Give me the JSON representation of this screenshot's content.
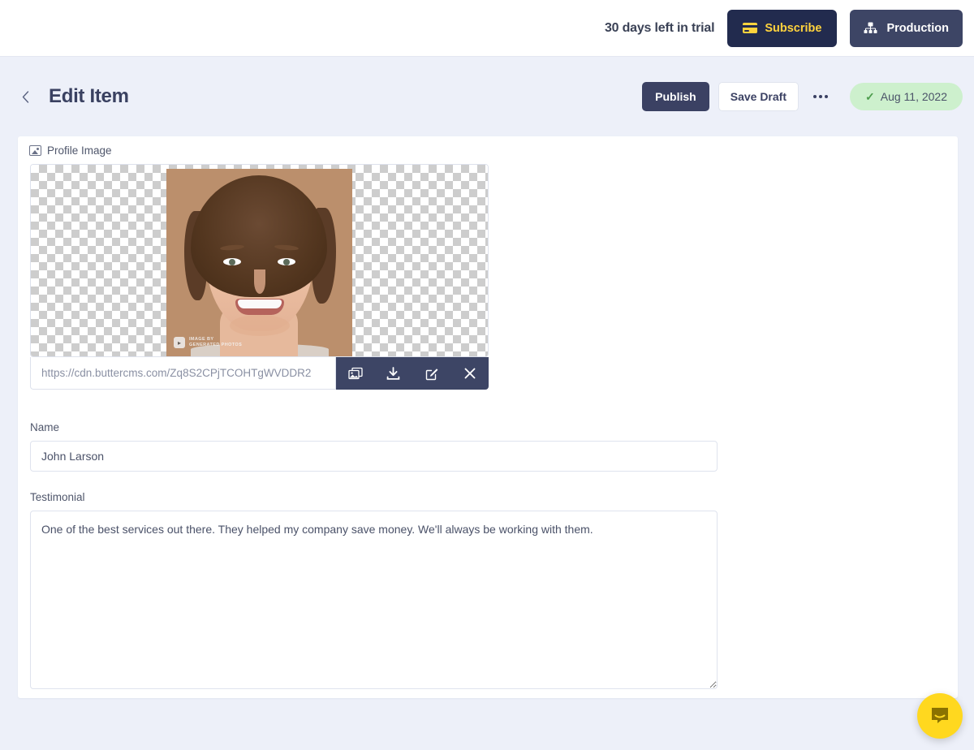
{
  "topbar": {
    "trial_text": "30 days left in trial",
    "subscribe_label": "Subscribe",
    "subscribe_icon": "credit-card-icon",
    "subscribe_bg": "#222b4e",
    "subscribe_color": "#ffd33d",
    "environment_label": "Production",
    "environment_icon": "sitemap-icon",
    "environment_bg": "#3d4565"
  },
  "header": {
    "back_icon": "chevron-left-icon",
    "title": "Edit Item",
    "publish_label": "Publish",
    "save_draft_label": "Save Draft",
    "more_icon": "ellipsis-icon",
    "status_check": "✓",
    "status_date": "Aug 11, 2022",
    "status_bg": "#cdf0cd"
  },
  "form": {
    "image_field": {
      "label": "Profile Image",
      "icon": "image-icon",
      "url_value": "https://cdn.buttercms.com/Zq8S2CPjTCOHTgWVDDR2",
      "url_placeholder": "https://cdn.buttercms.com/Zq8S2CPjTCOHTgWVDDR2",
      "watermark_line1": "IMAGE BY",
      "watermark_line2": "GENERATED PHOTOS",
      "toolbar": [
        {
          "name": "copy-image-icon",
          "title": "Copy image"
        },
        {
          "name": "download-icon",
          "title": "Download"
        },
        {
          "name": "edit-pencil-icon",
          "title": "Edit"
        },
        {
          "name": "close-icon",
          "title": "Remove"
        }
      ],
      "toolbar_bg": "#3d4565"
    },
    "name_field": {
      "label": "Name",
      "value": "John Larson",
      "placeholder": "Name"
    },
    "testimonial_field": {
      "label": "Testimonial",
      "value": "One of the best services out there. They helped my company save money. We'll always be working with them.",
      "placeholder": "Testimonial"
    }
  },
  "chat": {
    "icon": "chat-bubble-icon",
    "bg": "#ffd81f"
  }
}
